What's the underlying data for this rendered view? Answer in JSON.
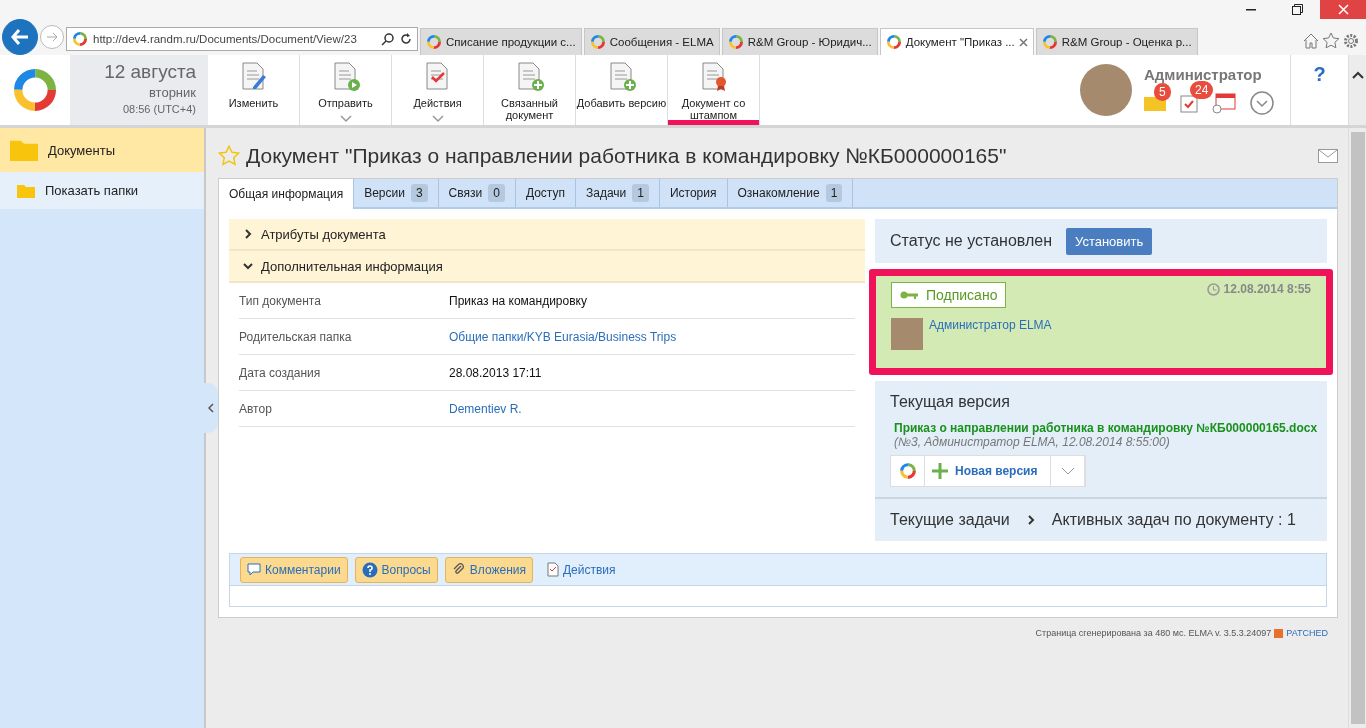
{
  "browser": {
    "url": "http://dev4.randm.ru/Documents/Document/View/23",
    "tabs": [
      {
        "title": "Списание продукции с...",
        "selected": false
      },
      {
        "title": "Сообщения - ELMA",
        "selected": false
      },
      {
        "title": "R&M Group - Юридич...",
        "selected": false
      },
      {
        "title": "Документ \"Приказ ...",
        "selected": true
      },
      {
        "title": "R&M Group - Оценка р...",
        "selected": false
      }
    ]
  },
  "header": {
    "date": "12 августа",
    "weekday": "вторник",
    "time": "08:56 (UTC+4)",
    "toolbar": [
      {
        "label": "Изменить",
        "has_menu": false,
        "highlighted": false
      },
      {
        "label": "Отправить",
        "has_menu": true,
        "highlighted": false
      },
      {
        "label": "Действия",
        "has_menu": true,
        "highlighted": false
      },
      {
        "label": "Связанный документ",
        "has_menu": false,
        "highlighted": false
      },
      {
        "label": "Добавить версию",
        "has_menu": false,
        "highlighted": false
      },
      {
        "label": "Документ со штампом",
        "has_menu": false,
        "highlighted": true
      }
    ],
    "user": {
      "name": "Администратор",
      "messages": "5",
      "tasks": "24"
    },
    "help": "?"
  },
  "sidebar": {
    "items": [
      {
        "label": "Документы",
        "selected": true
      },
      {
        "label": "Показать папки",
        "selected": false
      }
    ]
  },
  "document": {
    "title": "Документ \"Приказ о направлении работника в командировку №КБ000000165\"",
    "favorite": false,
    "tabs": [
      {
        "label": "Общая информация",
        "selected": true
      },
      {
        "label": "Версии",
        "count": "3",
        "selected": false
      },
      {
        "label": "Связи",
        "count": "0",
        "selected": false
      },
      {
        "label": "Доступ",
        "selected": false
      },
      {
        "label": "Задачи",
        "count": "1",
        "selected": false
      },
      {
        "label": "История",
        "selected": false
      },
      {
        "label": "Ознакомление",
        "count": "1",
        "selected": false
      }
    ],
    "sections": [
      {
        "title": "Атрибуты документа",
        "expanded": false
      },
      {
        "title": "Дополнительная информация",
        "expanded": true
      }
    ],
    "properties": [
      {
        "label": "Тип документа",
        "value": "Приказ на командировку",
        "kind": "text"
      },
      {
        "label": "Родительская папка",
        "value": "Общие папки/KYB Eurasia/Business Trips",
        "kind": "link"
      },
      {
        "label": "Дата создания",
        "value": "28.08.2013 17:11",
        "kind": "text"
      },
      {
        "label": "Автор",
        "value": "Dementiev R.",
        "kind": "link"
      }
    ],
    "status": {
      "text": "Статус не установлен",
      "button": "Установить"
    },
    "signature": {
      "state": "Подписано",
      "date": "12.08.2014 8:55",
      "signer": "Администратор ELMA",
      "highlighted": true
    },
    "version": {
      "title": "Текущая версия",
      "file": "Приказ о направлении работника в командировку №КБ000000165.docx",
      "meta": "(№3, Администратор ELMA, 12.08.2014 8:55:00)",
      "button": "Новая версия"
    },
    "tasks": {
      "title": "Текущие задачи",
      "summary": "Активных задач по документу : 1"
    },
    "bottom_tabs": [
      {
        "label": "Комментарии",
        "kind": "comment"
      },
      {
        "label": "Вопросы",
        "kind": "question"
      },
      {
        "label": "Вложения",
        "kind": "attachment"
      },
      {
        "label": "Действия",
        "kind": "actions"
      }
    ]
  },
  "footer": {
    "text": "Страница сгенерирована за 480 мс. ELMA v. 3.5.3.24097",
    "badge": "PATCHED"
  }
}
